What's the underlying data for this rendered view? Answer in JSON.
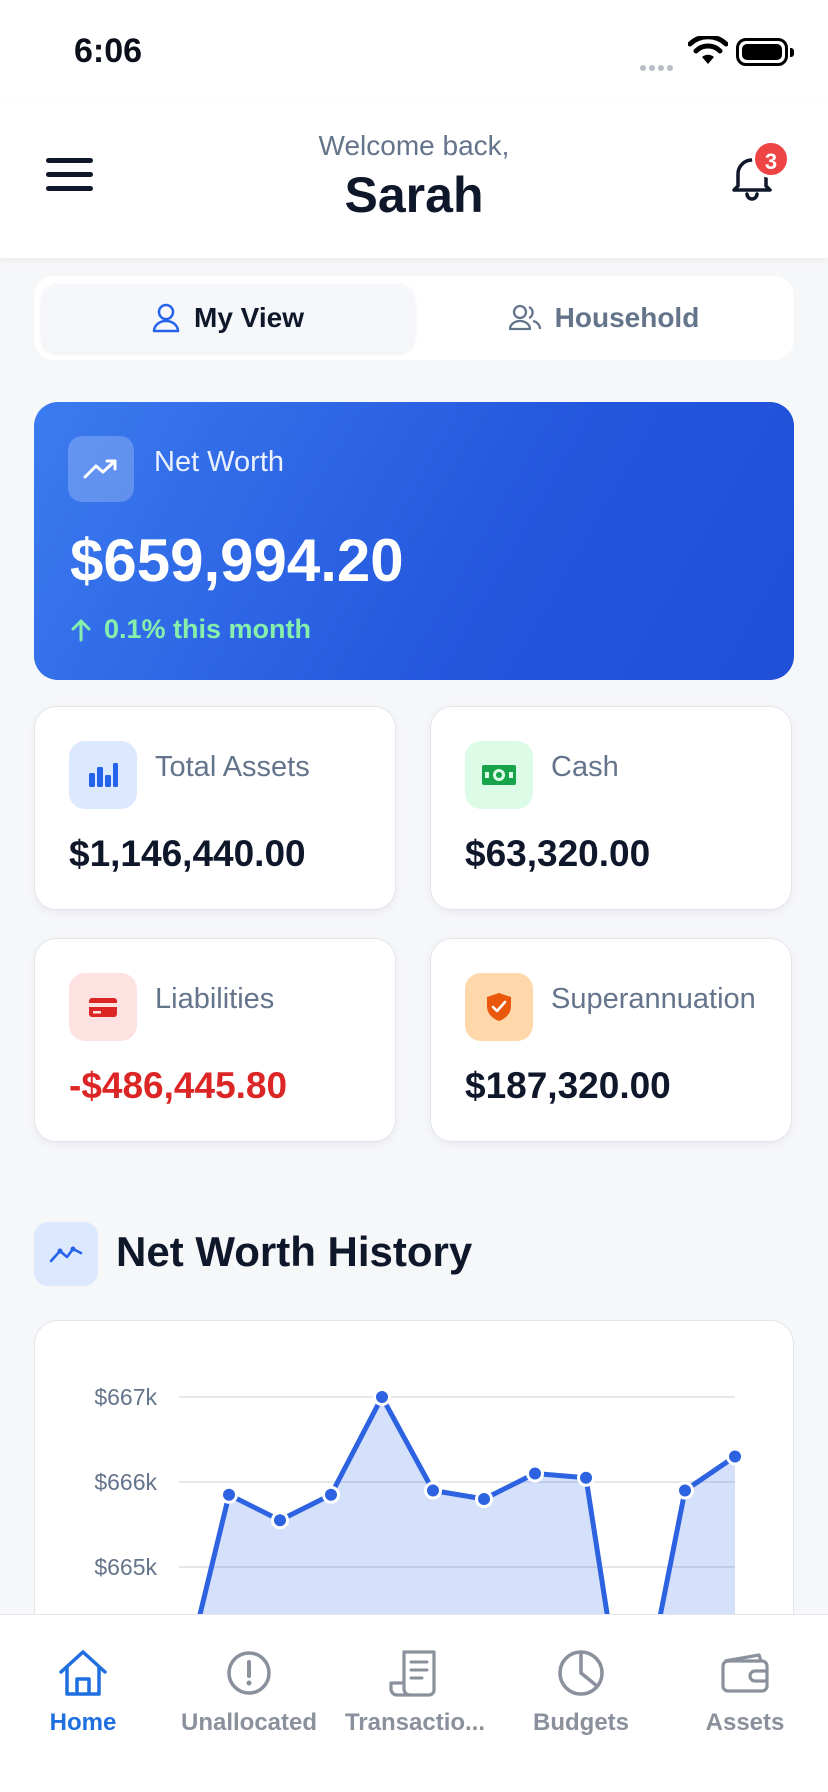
{
  "status_bar": {
    "time": "6:06"
  },
  "header": {
    "welcome": "Welcome back,",
    "name": "Sarah",
    "notification_count": "3"
  },
  "view_toggle": {
    "my_view": "My View",
    "household": "Household",
    "selected": "My View"
  },
  "net_worth": {
    "label": "Net Worth",
    "value": "$659,994.20",
    "change": "0.1% this month"
  },
  "stats": [
    {
      "label": "Total Assets",
      "value": "$1,146,440.00",
      "icon": "bar-chart-icon",
      "color": "#2563eb"
    },
    {
      "label": "Cash",
      "value": "$63,320.00",
      "icon": "banknote-icon",
      "color": "#16a34a"
    },
    {
      "label": "Liabilities",
      "value": "-$486,445.80",
      "icon": "credit-card-icon",
      "color": "#dc2626"
    },
    {
      "label": "Superannuation",
      "value": "$187,320.00",
      "icon": "shield-icon",
      "color": "#ea580c"
    }
  ],
  "history": {
    "title": "Net Worth History"
  },
  "chart_data": {
    "type": "area",
    "title": "Net Worth History",
    "y_ticks": [
      "$667k",
      "$666k",
      "$665k"
    ],
    "ylim": [
      664.3,
      667.3
    ],
    "values": [
      664.2,
      665.85,
      665.55,
      665.85,
      667.0,
      665.9,
      665.8,
      666.1,
      666.05,
      664.0,
      664.0,
      665.9,
      666.3
    ],
    "grid": true
  },
  "bottom_nav": [
    {
      "label": "Home",
      "icon": "home-icon",
      "active": true
    },
    {
      "label": "Unallocated",
      "icon": "alert-circle-icon",
      "active": false
    },
    {
      "label": "Transactio...",
      "icon": "receipt-icon",
      "active": false
    },
    {
      "label": "Budgets",
      "icon": "pie-chart-icon",
      "active": false
    },
    {
      "label": "Assets",
      "icon": "wallet-icon",
      "active": false
    }
  ],
  "colors": {
    "accent": "#1f6fe0",
    "positive": "#86efac",
    "negative": "#dc2626"
  }
}
